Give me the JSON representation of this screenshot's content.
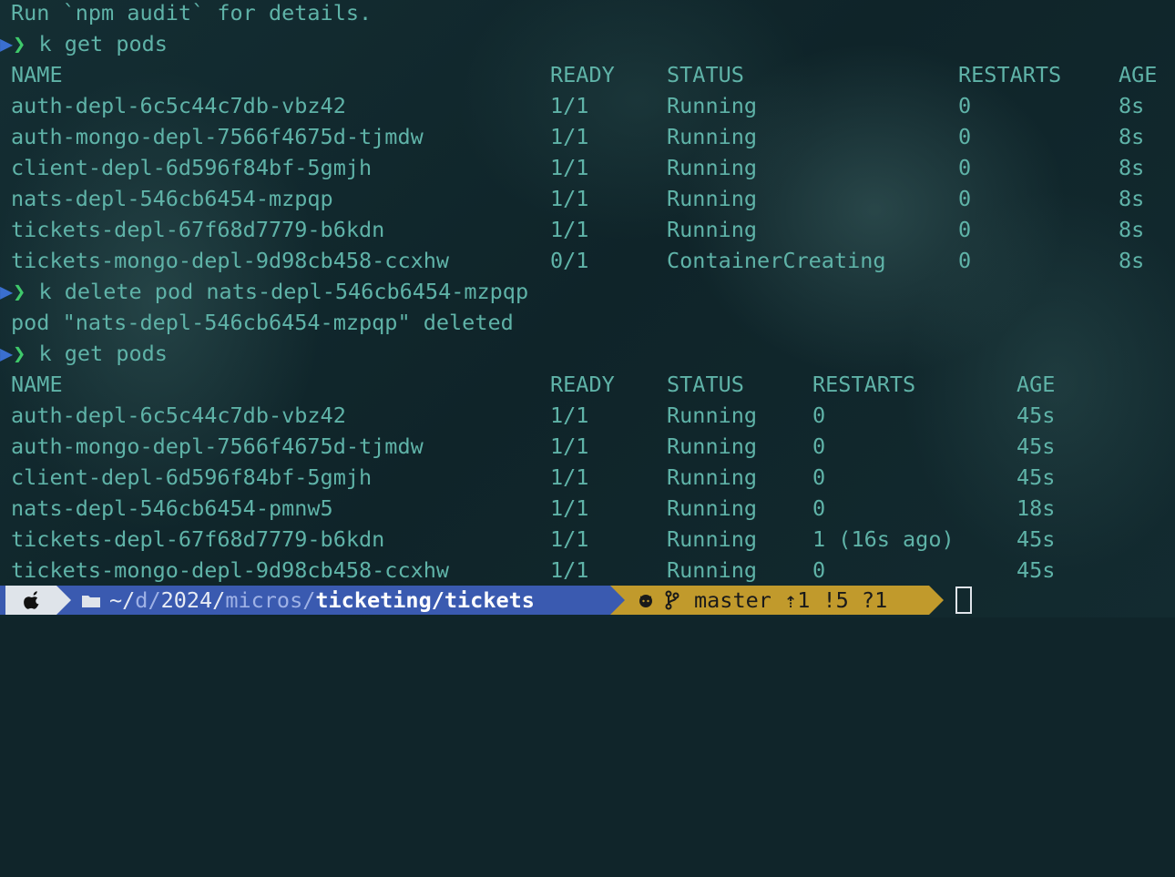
{
  "terminal": {
    "audit_line": "Run `npm audit` for details.",
    "prompt_symbol": "❯",
    "cmd1": "k get pods",
    "table1": {
      "headers": [
        "NAME",
        "READY",
        "STATUS",
        "RESTARTS",
        "AGE"
      ],
      "rows": [
        [
          "auth-depl-6c5c44c7db-vbz42",
          "1/1",
          "Running",
          "0",
          "8s"
        ],
        [
          "auth-mongo-depl-7566f4675d-tjmdw",
          "1/1",
          "Running",
          "0",
          "8s"
        ],
        [
          "client-depl-6d596f84bf-5gmjh",
          "1/1",
          "Running",
          "0",
          "8s"
        ],
        [
          "nats-depl-546cb6454-mzpqp",
          "1/1",
          "Running",
          "0",
          "8s"
        ],
        [
          "tickets-depl-67f68d7779-b6kdn",
          "1/1",
          "Running",
          "0",
          "8s"
        ],
        [
          "tickets-mongo-depl-9d98cb458-ccxhw",
          "0/1",
          "ContainerCreating",
          "0",
          "8s"
        ]
      ]
    },
    "cmd2": "k delete pod nats-depl-546cb6454-mzpqp",
    "delete_output": "pod \"nats-depl-546cb6454-mzpqp\" deleted",
    "cmd3": "k get pods",
    "table2": {
      "headers": [
        "NAME",
        "READY",
        "STATUS",
        "RESTARTS",
        "AGE"
      ],
      "rows": [
        [
          "auth-depl-6c5c44c7db-vbz42",
          "1/1",
          "Running",
          "0",
          "45s"
        ],
        [
          "auth-mongo-depl-7566f4675d-tjmdw",
          "1/1",
          "Running",
          "0",
          "45s"
        ],
        [
          "client-depl-6d596f84bf-5gmjh",
          "1/1",
          "Running",
          "0",
          "45s"
        ],
        [
          "nats-depl-546cb6454-pmnw5",
          "1/1",
          "Running",
          "0",
          "18s"
        ],
        [
          "tickets-depl-67f68d7779-b6kdn",
          "1/1",
          "Running",
          "1 (16s ago)",
          "45s"
        ],
        [
          "tickets-mongo-depl-9d98cb458-ccxhw",
          "1/1",
          "Running",
          "0",
          "45s"
        ]
      ]
    }
  },
  "powerline": {
    "path_home": "~/",
    "path_d": "d/",
    "path_2024": "2024/",
    "path_micros": "micros/",
    "path_ticketing": "ticketing/",
    "path_tickets": "tickets",
    "git_branch": "master",
    "git_status": "⇡1 !5 ?1"
  },
  "colors": {
    "text": "#5fb3a8",
    "prompt_chevron": "#3fc96b",
    "path_segment": "#3a5ab0",
    "git_segment": "#c19a2c",
    "apple_segment": "#dfe4ea"
  }
}
